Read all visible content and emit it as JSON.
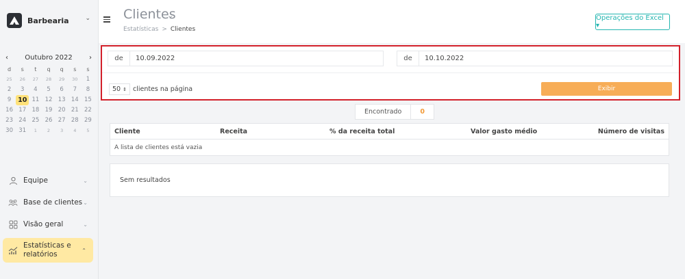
{
  "brand": {
    "name": "Barbearia"
  },
  "calendar": {
    "month_label": "Outubro 2022",
    "weekdays": [
      "d",
      "s",
      "t",
      "q",
      "q",
      "s",
      "s"
    ],
    "weeks": [
      [
        "25",
        "26",
        "27",
        "28",
        "29",
        "30",
        "1"
      ],
      [
        "2",
        "3",
        "4",
        "5",
        "6",
        "7",
        "8"
      ],
      [
        "9",
        "10",
        "11",
        "12",
        "13",
        "14",
        "15"
      ],
      [
        "16",
        "17",
        "18",
        "19",
        "20",
        "21",
        "22"
      ],
      [
        "23",
        "24",
        "25",
        "26",
        "27",
        "28",
        "29"
      ],
      [
        "30",
        "31",
        "1",
        "2",
        "3",
        "4",
        "5"
      ]
    ],
    "today": "10"
  },
  "menu": {
    "items": [
      {
        "label": "Equipe",
        "icon": "person-icon"
      },
      {
        "label": "Base de clientes",
        "icon": "people-icon"
      },
      {
        "label": "Visão geral",
        "icon": "grid-icon"
      }
    ],
    "active": {
      "label": "Estatísticas e relatórios",
      "icon": "chart-icon"
    }
  },
  "header": {
    "title": "Clientes",
    "breadcrumb": [
      "Estatísticas",
      "Clientes"
    ],
    "excel_button": "Operações do Excel ▾"
  },
  "filter": {
    "from_label": "de",
    "from_value": "10.09.2022",
    "to_label": "de",
    "to_value": "10.10.2022",
    "per_page_value": "50",
    "per_page_label": "clientes na página",
    "show_button": "Exibir"
  },
  "found": {
    "label": "Encontrado",
    "value": "0"
  },
  "table": {
    "columns": [
      "Cliente",
      "Receita",
      "% da receita total",
      "Valor gasto médio",
      "Número de visitas"
    ],
    "empty_message": "A lista de clientes está vazia"
  },
  "results": {
    "empty_message": "Sem resultados"
  },
  "colors": {
    "accent_orange": "#f7ad57",
    "teal": "#23b5b0",
    "highlight_yellow": "#ffe27a",
    "frame_red": "#d3202a"
  }
}
